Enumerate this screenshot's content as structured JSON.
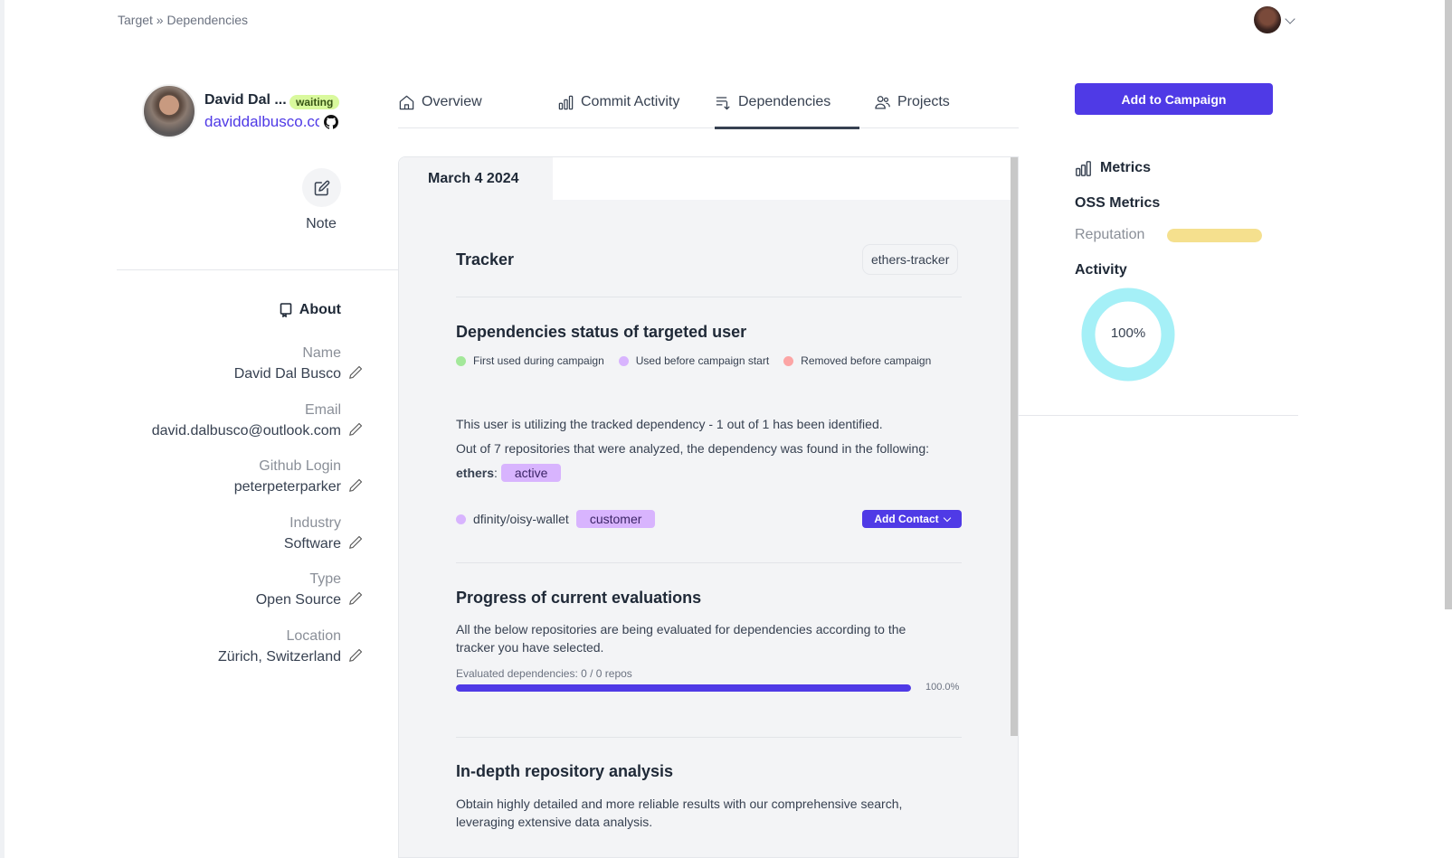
{
  "breadcrumb": {
    "text": "Target » Dependencies"
  },
  "profile": {
    "name": "David Dal ...",
    "status": "waiting",
    "website": "daviddalbusco.com",
    "note_label": "Note"
  },
  "about": {
    "title": "About",
    "fields": [
      {
        "label": "Name",
        "value": "David Dal Busco"
      },
      {
        "label": "Email",
        "value": "david.dalbusco@outlook.com"
      },
      {
        "label": "Github Login",
        "value": "peterpeterparker"
      },
      {
        "label": "Industry",
        "value": "Software"
      },
      {
        "label": "Type",
        "value": "Open Source"
      },
      {
        "label": "Location",
        "value": "Zürich, Switzerland"
      }
    ]
  },
  "tabs": [
    {
      "label": "Overview",
      "icon": "home-icon"
    },
    {
      "label": "Commit Activity",
      "icon": "bar-chart-icon"
    },
    {
      "label": "Dependencies",
      "icon": "sort-list-icon",
      "active": true
    },
    {
      "label": "Projects",
      "icon": "users-icon"
    }
  ],
  "main": {
    "date_tab": "March 4 2024",
    "tracker": {
      "title": "Tracker",
      "value": "ethers-tracker"
    },
    "status": {
      "title": "Dependencies status of targeted user",
      "legend": [
        {
          "label": "First used during campaign",
          "color": "#a3e89a"
        },
        {
          "label": "Used before campaign start",
          "color": "#d8b4fe"
        },
        {
          "label": "Removed before campaign",
          "color": "#fca5a5"
        }
      ],
      "summary_line1": "This user is utilizing the tracked dependency - 1 out of 1 has been identified.",
      "summary_line2": "Out of 7 repositories that were analyzed, the dependency was found in the following:",
      "dependency_name": "ethers",
      "dependency_colon": ":",
      "dependency_state": "active",
      "repo": {
        "name": "dfinity/oisy-wallet",
        "tag": "customer",
        "dot_color": "#d8b4fe"
      },
      "add_contact_label": "Add Contact"
    },
    "progress": {
      "title": "Progress of current evaluations",
      "description": "All the below repositories are being evaluated for dependencies according to the tracker you have selected.",
      "caption": "Evaluated dependencies: 0 / 0 repos",
      "percent_value": 100.0,
      "percent_label": "100.0%"
    },
    "analysis": {
      "title": "In-depth repository analysis",
      "description": "Obtain highly detailed and more reliable results with our comprehensive search, leveraging extensive data analysis."
    }
  },
  "sidebar_right": {
    "campaign_button": "Add to Campaign",
    "metrics_title": "Metrics",
    "oss_title": "OSS Metrics",
    "reputation_label": "Reputation",
    "reputation_fraction": 1.0,
    "activity_title": "Activity",
    "activity_percent": 100,
    "activity_label": "100%",
    "activity_color": "#a5f0f7"
  },
  "colors": {
    "accent": "#4f3ae6",
    "badge_waiting": "#d9f99d",
    "reputation": "#f5e08e"
  }
}
